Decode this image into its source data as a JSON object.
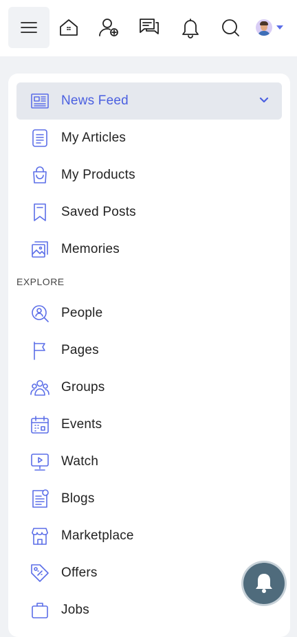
{
  "topbar": {
    "icons": [
      "menu-icon",
      "home-icon",
      "friends-icon",
      "chat-icon",
      "bell-icon",
      "search-icon"
    ]
  },
  "nav": {
    "items": [
      {
        "label": "News Feed",
        "icon": "newspaper-icon",
        "active": true
      },
      {
        "label": "My Articles",
        "icon": "article-icon"
      },
      {
        "label": "My Products",
        "icon": "shopping-bag-icon"
      },
      {
        "label": "Saved Posts",
        "icon": "bookmark-icon"
      },
      {
        "label": "Memories",
        "icon": "photos-icon"
      }
    ],
    "explore_label": "EXPLORE",
    "explore_items": [
      {
        "label": "People",
        "icon": "people-search-icon"
      },
      {
        "label": "Pages",
        "icon": "flag-icon"
      },
      {
        "label": "Groups",
        "icon": "group-icon"
      },
      {
        "label": "Events",
        "icon": "calendar-icon"
      },
      {
        "label": "Watch",
        "icon": "video-play-icon"
      },
      {
        "label": "Blogs",
        "icon": "blog-icon"
      },
      {
        "label": "Marketplace",
        "icon": "store-icon"
      },
      {
        "label": "Offers",
        "icon": "tag-icon"
      },
      {
        "label": "Jobs",
        "icon": "briefcase-icon"
      }
    ]
  },
  "colors": {
    "accent": "#5b6ee8",
    "active_bg": "#e5e8ee",
    "fab": "#4f6b7c"
  }
}
